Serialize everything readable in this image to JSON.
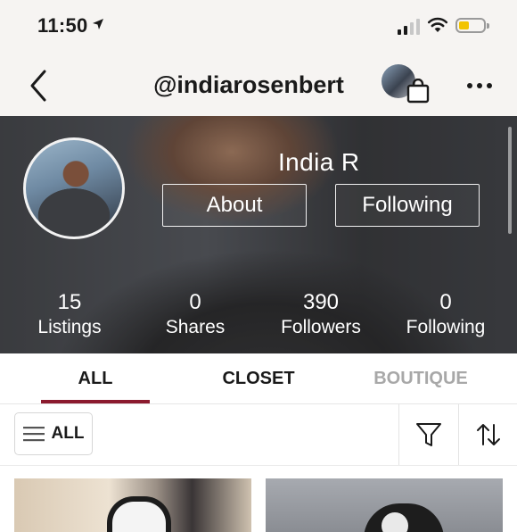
{
  "status": {
    "time": "11:50",
    "icons": [
      "location-arrow-icon",
      "signal-icon",
      "wifi-icon",
      "battery-icon"
    ],
    "battery_color": "#f2c400"
  },
  "nav": {
    "username": "@indiarosenbert",
    "icons": [
      "back-chevron-icon",
      "shopping-bag-icon",
      "more-dots-icon"
    ]
  },
  "profile": {
    "display_name": "India R",
    "about_label": "About",
    "following_button_label": "Following",
    "stats": [
      {
        "value": "15",
        "label": "Listings"
      },
      {
        "value": "0",
        "label": "Shares"
      },
      {
        "value": "390",
        "label": "Followers"
      },
      {
        "value": "0",
        "label": "Following"
      }
    ]
  },
  "tabs": {
    "items": [
      {
        "label": "ALL",
        "active": true
      },
      {
        "label": "CLOSET",
        "active": false
      },
      {
        "label": "BOUTIQUE",
        "active": false
      }
    ],
    "active_color": "#8b1a2e"
  },
  "filters": {
    "all_label": "ALL",
    "icons": [
      "hamburger-icon",
      "funnel-filter-icon",
      "sort-arrows-icon"
    ]
  }
}
